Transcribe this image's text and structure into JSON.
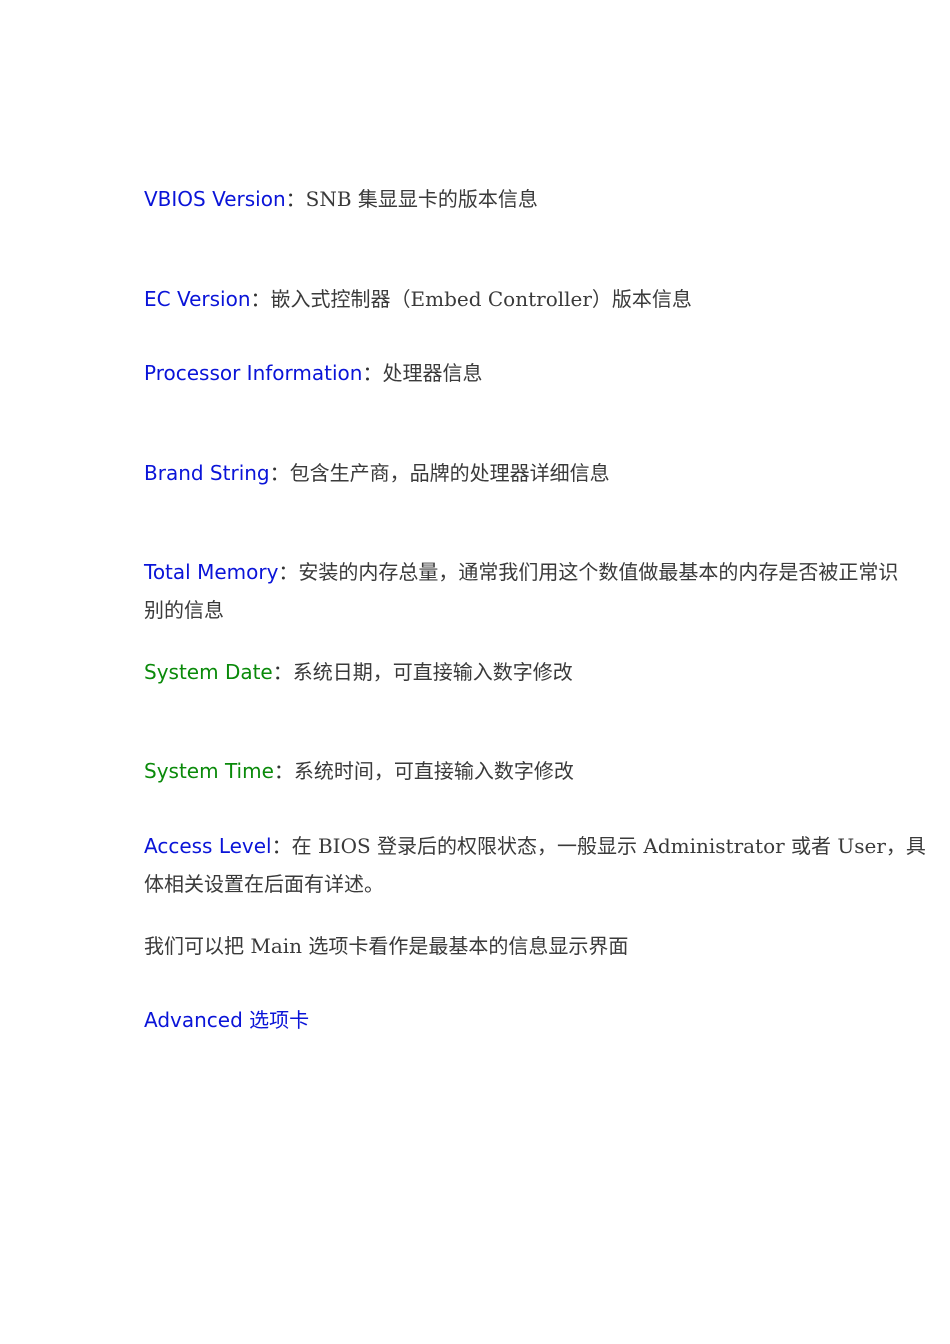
{
  "entries": [
    {
      "term": "VBIOS Version",
      "sep": "：",
      "desc": "SNB 集显显卡的版本信息"
    },
    {
      "term": "EC Version",
      "sep": "：",
      "desc": "嵌入式控制器（Embed Controller）版本信息"
    },
    {
      "term": "Processor Information",
      "sep": "：",
      "desc": "处理器信息"
    },
    {
      "term": "Brand String",
      "sep": "：",
      "desc": "包含生产商，品牌的处理器详细信息"
    },
    {
      "term": "Total Memory",
      "sep": "：",
      "desc": "安装的内存总量，通常我们用这个数值做最基本的内存是否被正常识",
      "desc2": "别的信息"
    },
    {
      "term": "System Date",
      "sep": "：",
      "desc": "系统日期，可直接输入数字修改"
    },
    {
      "term": "System Time",
      "sep": "：",
      "desc": "系统时间，可直接输入数字修改"
    },
    {
      "term": "Access Level",
      "sep": "：",
      "desc": "在 BIOS 登录后的权限状态，一般显示 Administrator 或者 User，具",
      "desc2": "体相关设置在后面有详述。"
    }
  ],
  "summary": "我们可以把 Main 选项卡看作是最基本的信息显示界面",
  "next_heading": "Advanced 选项卡",
  "colors": {
    "blue": "#0a14d8",
    "green": "#0a8a0a",
    "text": "#3a3a3a"
  }
}
